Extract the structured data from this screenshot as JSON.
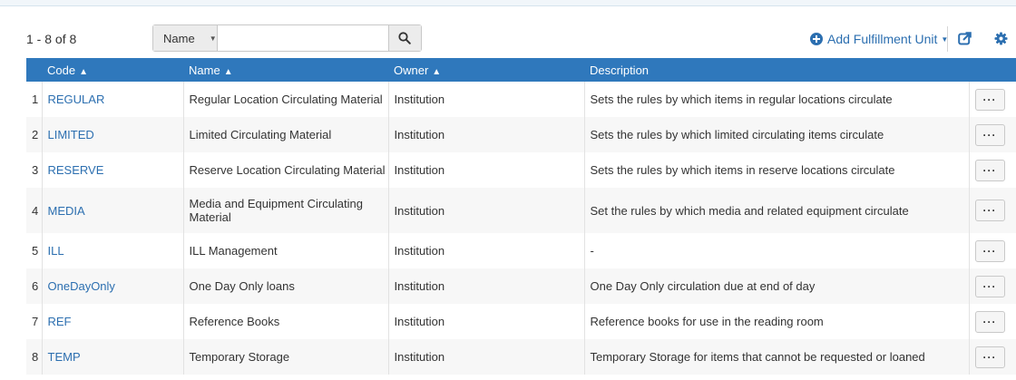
{
  "count": "1 - 8 of 8",
  "search": {
    "field_label": "Name",
    "value": "",
    "placeholder": ""
  },
  "actions": {
    "add_label": "Add Fulfillment Unit"
  },
  "colors": {
    "header_bg": "#2f78bc",
    "link": "#2c6fb0"
  },
  "table": {
    "headers": {
      "code": "Code",
      "name": "Name",
      "owner": "Owner",
      "description": "Description"
    },
    "rows": [
      {
        "n": "1",
        "code": "REGULAR",
        "name": "Regular Location Circulating Material",
        "owner": "Institution",
        "description": "Sets the rules by which items in regular locations circulate",
        "more": "···"
      },
      {
        "n": "2",
        "code": "LIMITED",
        "name": "Limited Circulating Material",
        "owner": "Institution",
        "description": "Sets the rules by which limited circulating items circulate",
        "more": "···"
      },
      {
        "n": "3",
        "code": "RESERVE",
        "name": "Reserve Location Circulating Material",
        "owner": "Institution",
        "description": "Sets the rules by which items in reserve locations circulate",
        "more": "···"
      },
      {
        "n": "4",
        "code": "MEDIA",
        "name": "Media and Equipment Circulating Material",
        "owner": "Institution",
        "description": "Set the rules by which media and related equipment circulate",
        "more": "···"
      },
      {
        "n": "5",
        "code": "ILL",
        "name": "ILL Management",
        "owner": "Institution",
        "description": "-",
        "more": "···"
      },
      {
        "n": "6",
        "code": "OneDayOnly",
        "name": "One Day Only loans",
        "owner": "Institution",
        "description": "One Day Only circulation due at end of day",
        "more": "···"
      },
      {
        "n": "7",
        "code": "REF",
        "name": "Reference Books",
        "owner": "Institution",
        "description": "Reference books for use in the reading room",
        "more": "···"
      },
      {
        "n": "8",
        "code": "TEMP",
        "name": "Temporary Storage",
        "owner": "Institution",
        "description": "Temporary Storage for items that cannot be requested or loaned",
        "more": "···"
      }
    ]
  }
}
